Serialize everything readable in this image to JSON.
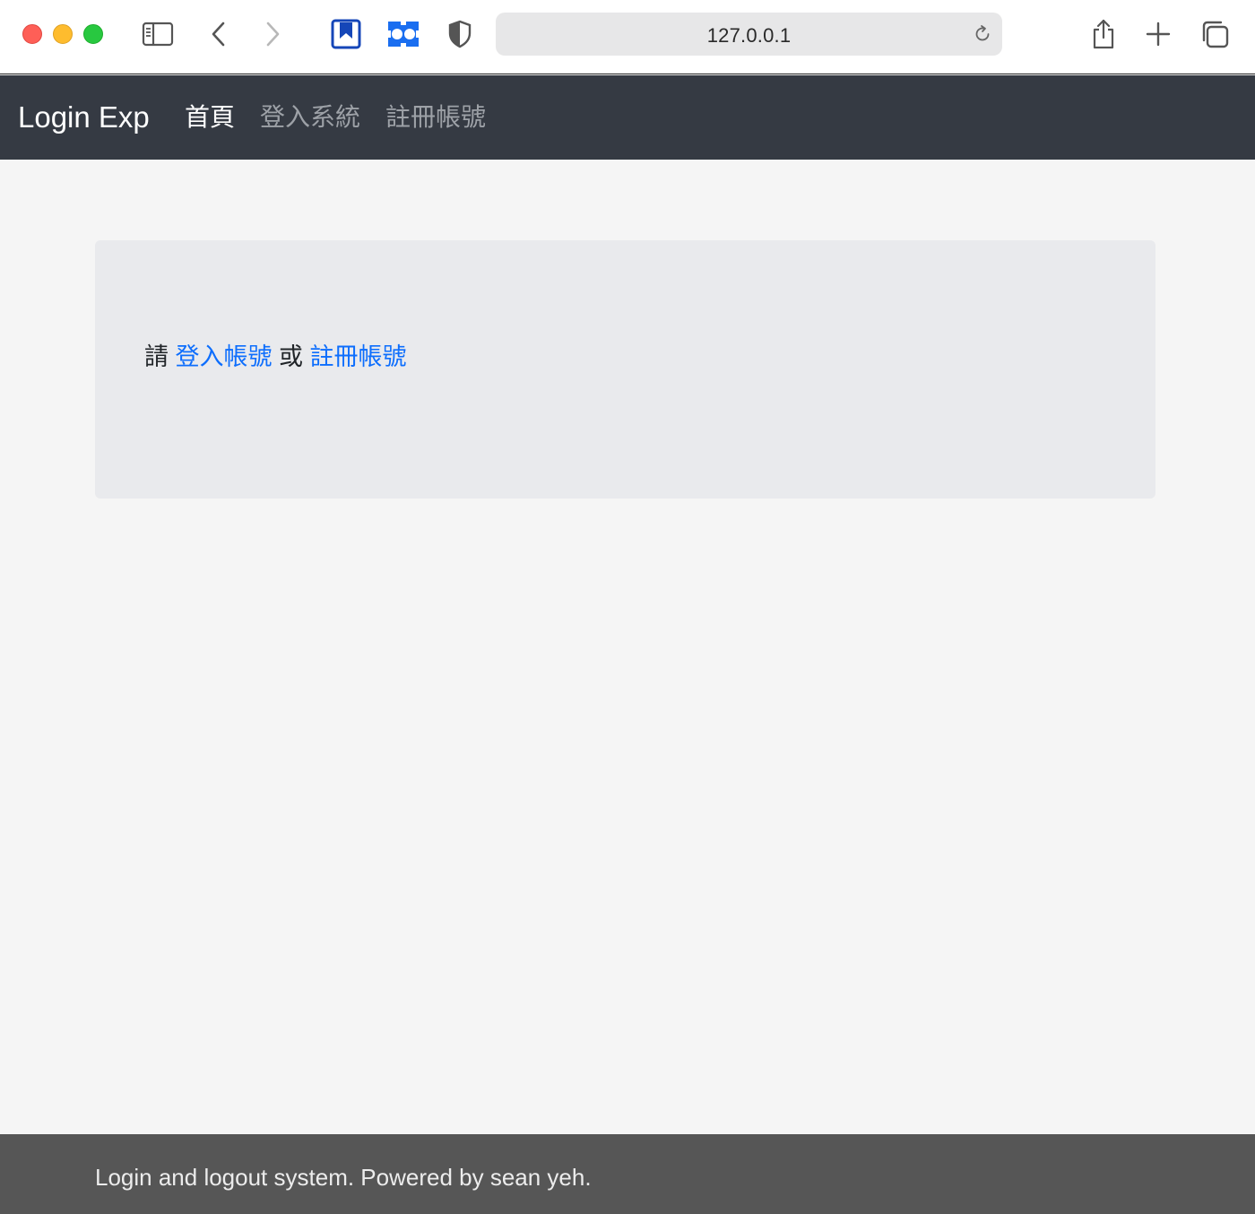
{
  "browser": {
    "url": "127.0.0.1",
    "icons": {
      "sidebar": "sidebar-icon",
      "back": "chevron-left-icon",
      "forward": "chevron-right-icon",
      "bookmark": "bookmark-extension-icon",
      "extension": "extension-icon",
      "privacy": "shield-icon",
      "reload": "reload-icon",
      "share": "share-icon",
      "new_tab": "plus-icon",
      "tabs": "tab-overview-icon"
    }
  },
  "navbar": {
    "brand": "Login Exp",
    "items": [
      {
        "label": "首頁",
        "active": true
      },
      {
        "label": "登入系統",
        "active": false
      },
      {
        "label": "註冊帳號",
        "active": false
      }
    ],
    "background": "#353a43"
  },
  "main": {
    "prefix": "請",
    "login_link": "登入帳號",
    "separator": "或",
    "register_link": "註冊帳號",
    "link_color": "#0d6efd"
  },
  "footer": {
    "text": "Login and logout system. Powered by sean yeh."
  }
}
